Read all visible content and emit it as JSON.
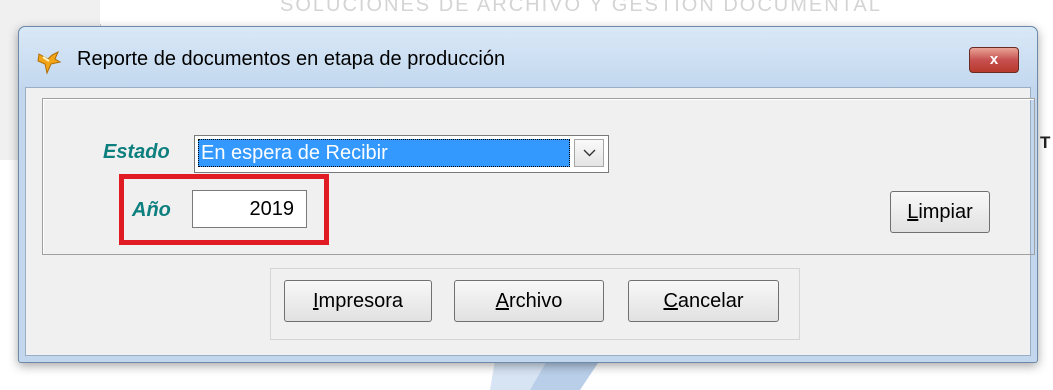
{
  "background": {
    "faded_text": "SOLUCIONES DE ARCHIVO Y GESTION DOCUMENTAL",
    "stray_letter": "T"
  },
  "dialog": {
    "title": "Reporte de documentos en etapa de producción",
    "title_icon": "wrench-icon",
    "close_label": "x"
  },
  "form": {
    "estado_label": "Estado",
    "estado_value": "En espera de Recibir",
    "anio_label": "Año",
    "anio_value": "2019",
    "limpiar": {
      "mnemonic": "L",
      "rest": "impiar"
    }
  },
  "buttons": {
    "impresora": {
      "mnemonic": "I",
      "rest": "mpresora"
    },
    "archivo": {
      "mnemonic": "A",
      "rest": "rchivo"
    },
    "cancelar": {
      "mnemonic": "C",
      "rest": "ancelar"
    }
  },
  "colors": {
    "label_teal": "#0e7f7f",
    "selection_blue": "#3399ff",
    "highlight_red": "#e01b24",
    "close_red": "#c75050"
  }
}
